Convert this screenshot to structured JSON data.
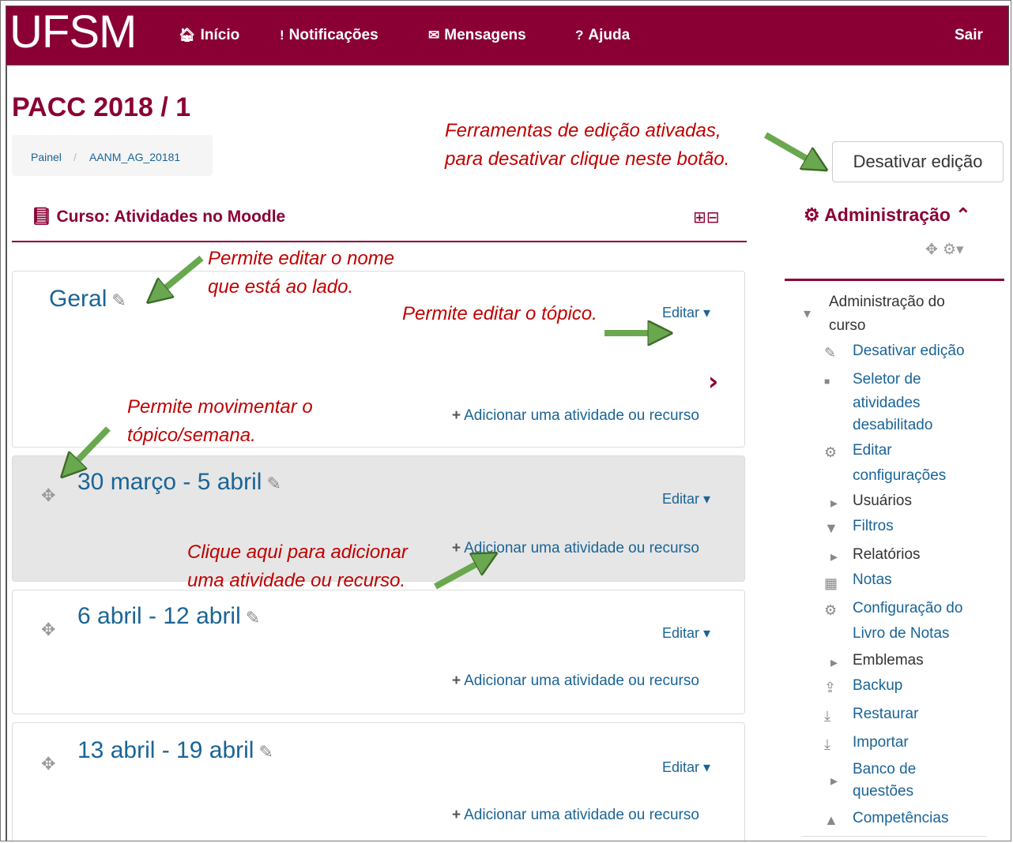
{
  "topbar": {
    "logo": "UFSM",
    "nav": [
      {
        "icon": "home-icon",
        "label": "Início"
      },
      {
        "icon": "notification-icon",
        "label": "Notificações"
      },
      {
        "icon": "envelope-icon",
        "label": "Mensagens"
      },
      {
        "icon": "help-icon",
        "label": "Ajuda"
      }
    ],
    "logout": "Sair",
    "color": "#8a0035"
  },
  "page": {
    "title": "PACC 2018 / 1",
    "breadcrumb": [
      "Painel",
      "AANM_AG_20181"
    ],
    "toggle_edit_button": "Desativar edição"
  },
  "course": {
    "heading": "Curso: Atividades no Moodle",
    "sections": [
      {
        "title": "Geral",
        "edit": "Editar",
        "add": "Adicionar uma atividade ou recurso"
      },
      {
        "title": "30 março - 5 abril",
        "edit": "Editar",
        "add": "Adicionar uma atividade ou recurso"
      },
      {
        "title": "6 abril - 12 abril",
        "edit": "Editar",
        "add": "Adicionar uma atividade ou recurso"
      },
      {
        "title": "13 abril - 19 abril",
        "edit": "Editar",
        "add": "Adicionar uma atividade ou recurso"
      }
    ]
  },
  "admin": {
    "heading": "Administração",
    "items": [
      {
        "label": "Administração do",
        "type": "plain"
      },
      {
        "label": "curso",
        "type": "plain"
      },
      {
        "label": "Desativar edição",
        "type": "link",
        "icon": "pencil-icon"
      },
      {
        "label": "Seletor de",
        "type": "link",
        "icon": "bullet-icon"
      },
      {
        "label": "atividades",
        "type": "link"
      },
      {
        "label": "desabilitado",
        "type": "link"
      },
      {
        "label": "Editar",
        "type": "link",
        "icon": "gear-icon"
      },
      {
        "label": "configurações",
        "type": "link"
      },
      {
        "label": "Usuários",
        "type": "plain",
        "icon": "caret-right-icon"
      },
      {
        "label": "Filtros",
        "type": "link",
        "icon": "filter-icon"
      },
      {
        "label": "Relatórios",
        "type": "plain",
        "icon": "caret-right-icon"
      },
      {
        "label": "Notas",
        "type": "link",
        "icon": "table-icon"
      },
      {
        "label": "Configuração do",
        "type": "link",
        "icon": "gear-icon"
      },
      {
        "label": "Livro de Notas",
        "type": "link"
      },
      {
        "label": "Emblemas",
        "type": "plain",
        "icon": "caret-right-icon"
      },
      {
        "label": "Backup",
        "type": "link",
        "icon": "upload-icon"
      },
      {
        "label": "Restaurar",
        "type": "link",
        "icon": "download-icon"
      },
      {
        "label": "Importar",
        "type": "link",
        "icon": "download-icon"
      },
      {
        "label": "Banco de",
        "type": "link",
        "icon": "caret-right-icon"
      },
      {
        "label": "questões",
        "type": "link"
      },
      {
        "label": "Competências",
        "type": "link",
        "icon": "competency-icon"
      }
    ]
  },
  "annotations": {
    "edit_tools_1": "Ferramentas de edição ativadas,",
    "edit_tools_2": "para desativar clique neste botão.",
    "rename_1": "Permite editar o nome",
    "rename_2": "que está ao lado.",
    "edit_topic": "Permite editar o tópico.",
    "move_1": "Permite movimentar o",
    "move_2": "tópico/semana.",
    "add_1": "Clique aqui para adicionar",
    "add_2": "uma atividade ou recurso.",
    "arrow_color": "#6aa84f"
  }
}
